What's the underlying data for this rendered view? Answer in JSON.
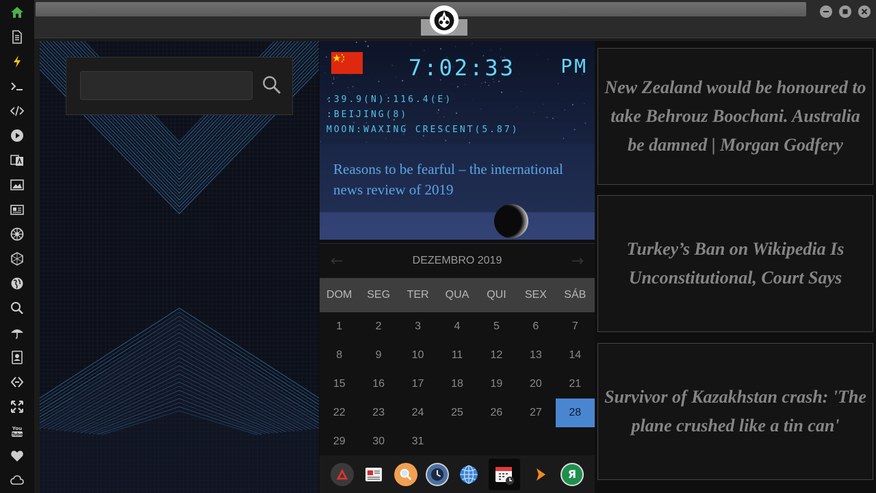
{
  "sidebar": {
    "icons": [
      "home-icon",
      "document-icon",
      "lightning-icon",
      "terminal-icon",
      "code-icon",
      "play-icon",
      "translate-icon",
      "image-icon",
      "news-icon",
      "empire-icon",
      "hexagon-icon",
      "globe-icon",
      "search-icon",
      "umbrella-icon",
      "contacts-icon",
      "link-icon",
      "expand-icon",
      "youtube-icon",
      "heart-icon",
      "cloud-icon"
    ],
    "active_color": "#4caf50"
  },
  "search": {
    "value": "",
    "placeholder": ""
  },
  "clock": {
    "time": "7:02:33",
    "ampm": "PM",
    "coords": ":39.9(N):116.4(E)",
    "location": ":BEIJING(8)",
    "moon": "MOON:WAXING CRESCENT(5.87)",
    "headline": "Reasons to be fearful – the international news review of 2019"
  },
  "calendar": {
    "month": "DEZEMBRO 2019",
    "prev": "←",
    "next": "→",
    "weekdays": [
      "DOM",
      "SEG",
      "TER",
      "QUA",
      "QUI",
      "SEX",
      "SÁB"
    ],
    "days": [
      "1",
      "2",
      "3",
      "4",
      "5",
      "6",
      "7",
      "8",
      "9",
      "10",
      "11",
      "12",
      "13",
      "14",
      "15",
      "16",
      "17",
      "18",
      "19",
      "20",
      "21",
      "22",
      "23",
      "24",
      "25",
      "26",
      "27",
      "28",
      "29",
      "30",
      "31"
    ],
    "today": "28"
  },
  "dock": {
    "items": [
      "arrow-app-icon",
      "newspaper-icon",
      "magnifier-icon",
      "clock-icon",
      "globe-icon",
      "calendar-icon",
      "play-arrow-icon",
      "yandex-icon"
    ],
    "yandex_letter": "Я"
  },
  "news": [
    "New Zealand would be honoured to take Behrouz Boochani. Australia be damned | Morgan Godfery",
    "Turkey’s Ban on Wikipedia Is Unconstitutional, Court Says",
    "Survivor of Kazakhstan crash: 'The plane crushed like a tin can'"
  ]
}
